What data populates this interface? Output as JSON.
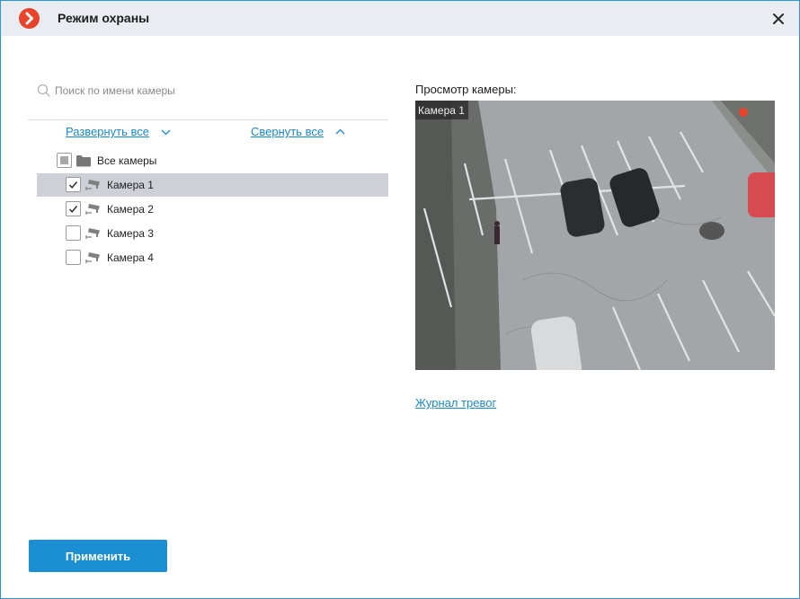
{
  "window": {
    "title": "Режим охраны",
    "logo_icon": "chevron-right-logo-icon",
    "close_icon": "close-icon"
  },
  "search": {
    "placeholder": "Поиск по имени камеры",
    "value": ""
  },
  "tree_controls": {
    "expand_all": "Развернуть все",
    "collapse_all": "Свернуть все"
  },
  "tree": {
    "root": {
      "label": "Все камеры",
      "state": "partial"
    },
    "items": [
      {
        "label": "Камера 1",
        "checked": true,
        "selected": true
      },
      {
        "label": "Камера 2",
        "checked": true,
        "selected": false
      },
      {
        "label": "Камера 3",
        "checked": false,
        "selected": false
      },
      {
        "label": "Камера 4",
        "checked": false,
        "selected": false
      }
    ]
  },
  "preview": {
    "label": "Просмотр камеры:",
    "camera_name": "Камера 1"
  },
  "links": {
    "alarm_log": "Журнал тревог"
  },
  "footer": {
    "apply_label": "Применить"
  },
  "colors": {
    "accent": "#1b8fd2",
    "link": "#1b87c9",
    "logo": "#e8432b",
    "selection": "#cdd0d6"
  }
}
